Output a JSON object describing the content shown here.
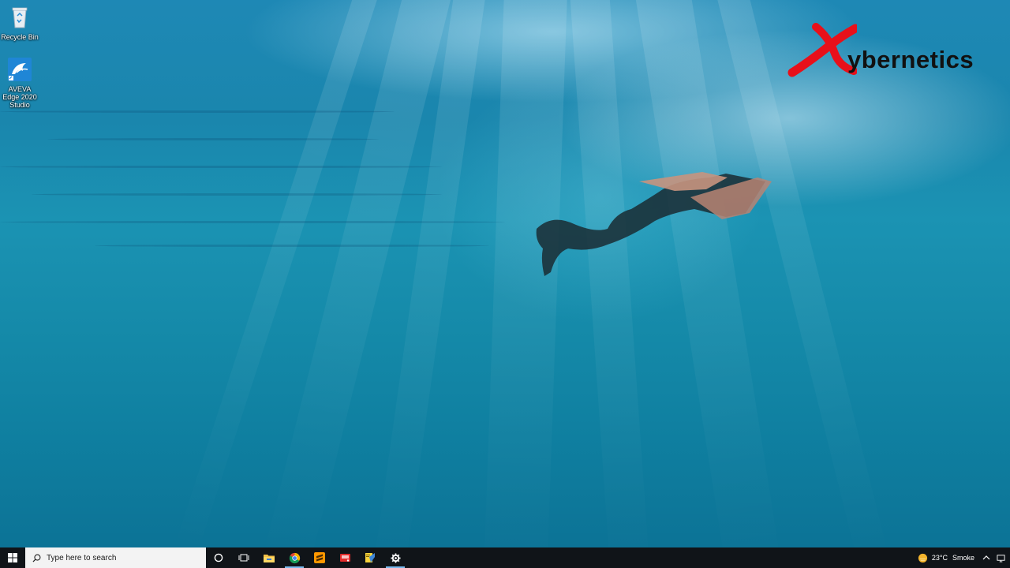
{
  "desktop": {
    "icons": [
      {
        "label": "Recycle Bin",
        "icon": "recycle-bin-icon"
      },
      {
        "label": "AVEVA Edge 2020 Studio",
        "icon": "aveva-edge-icon"
      }
    ],
    "logo": {
      "mark": "X",
      "text": "ybernetics",
      "mark_color": "#e8101a",
      "text_color": "#111111"
    }
  },
  "taskbar": {
    "search_placeholder": "Type here to search",
    "pinned": [
      {
        "name": "cortana",
        "icon": "cortana-circle-icon"
      },
      {
        "name": "task-view",
        "icon": "task-view-icon"
      },
      {
        "name": "file-explorer",
        "icon": "folder-icon"
      },
      {
        "name": "chrome",
        "icon": "chrome-icon"
      },
      {
        "name": "sublime-text",
        "icon": "sublime-icon"
      },
      {
        "name": "app-red",
        "icon": "red-app-icon"
      },
      {
        "name": "app-notes",
        "icon": "notes-app-icon"
      },
      {
        "name": "settings",
        "icon": "gear-icon"
      }
    ],
    "weather": {
      "temp": "23°C",
      "condition": "Smoke"
    },
    "accent": "#76b9ed"
  }
}
